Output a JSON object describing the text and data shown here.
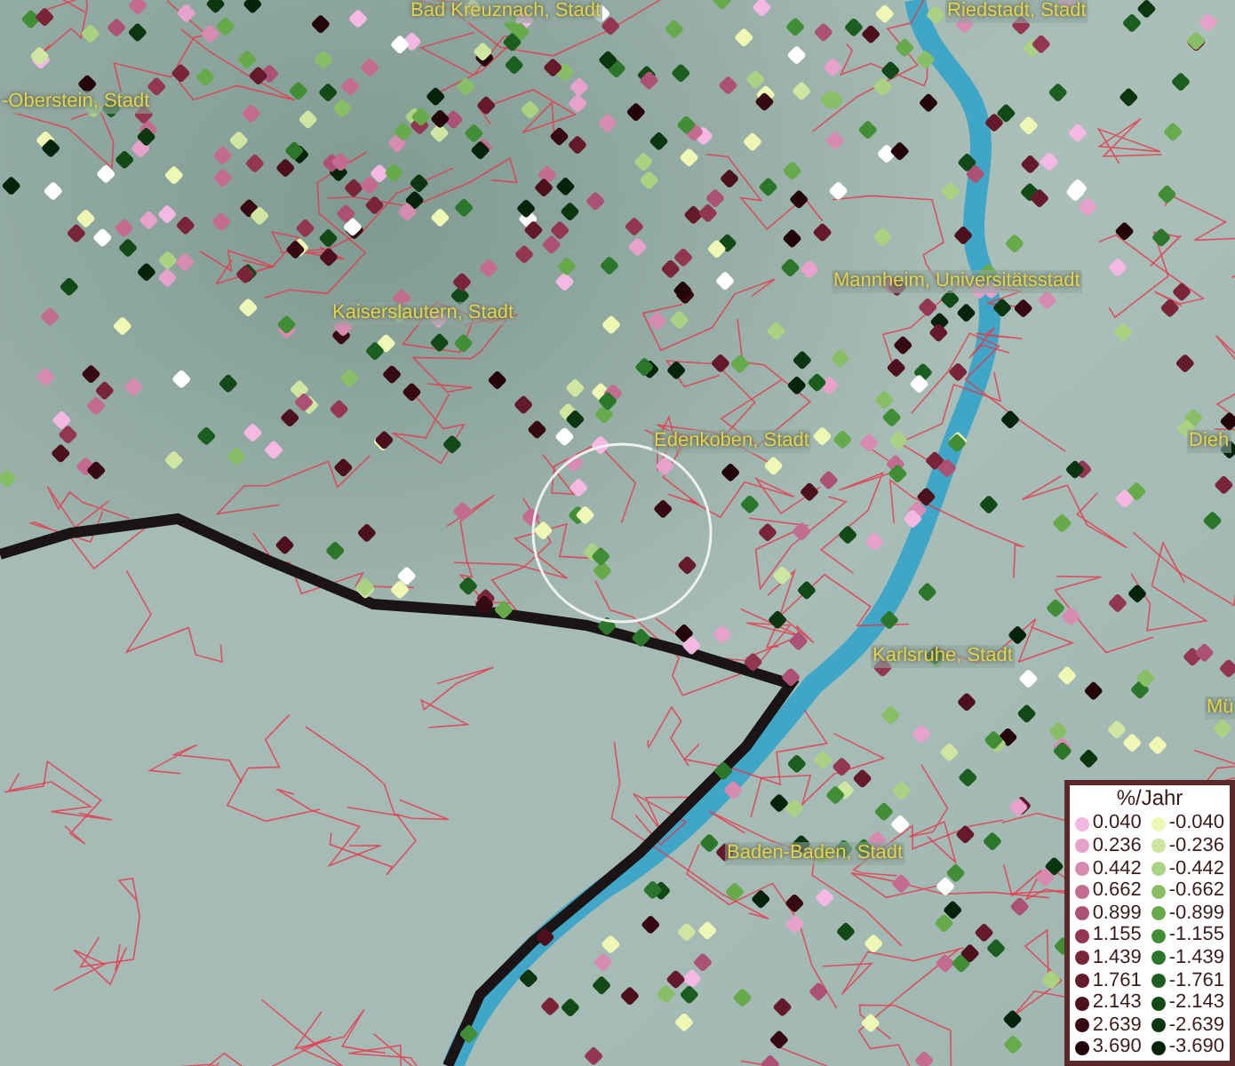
{
  "map": {
    "places": [
      {
        "name": "Bad Kreuznach, Stadt"
      },
      {
        "name": "Riedstadt, Stadt"
      },
      {
        "name": "-Oberstein, Stadt"
      },
      {
        "name": "Mannheim, Universitätsstadt"
      },
      {
        "name": "Kaiserslautern, Stadt"
      },
      {
        "name": "Edenkoben, Stadt"
      },
      {
        "name": "Dieh"
      },
      {
        "name": "Karlsruhe, Stadt"
      },
      {
        "name": "Mü"
      },
      {
        "name": "Baden-Baden, Stadt"
      }
    ]
  },
  "legend": {
    "title": "%/Jahr",
    "rows": [
      {
        "positive": {
          "label": "0.040",
          "color": "#f4b8e2"
        },
        "negative": {
          "label": "-0.040",
          "color": "#eef7b4"
        }
      },
      {
        "positive": {
          "label": "0.236",
          "color": "#e7a2cb"
        },
        "negative": {
          "label": "-0.236",
          "color": "#cfe6a2"
        }
      },
      {
        "positive": {
          "label": "0.442",
          "color": "#d88bb0"
        },
        "negative": {
          "label": "-0.442",
          "color": "#abd283"
        }
      },
      {
        "positive": {
          "label": "0.662",
          "color": "#c46c90"
        },
        "negative": {
          "label": "-0.662",
          "color": "#88bf66"
        }
      },
      {
        "positive": {
          "label": "0.899",
          "color": "#ac5074"
        },
        "negative": {
          "label": "-0.899",
          "color": "#66aa4c"
        }
      },
      {
        "positive": {
          "label": "1.155",
          "color": "#933652"
        },
        "negative": {
          "label": "-1.155",
          "color": "#418e36"
        }
      },
      {
        "positive": {
          "label": "1.439",
          "color": "#7a243a"
        },
        "negative": {
          "label": "-1.439",
          "color": "#2b762a"
        }
      },
      {
        "positive": {
          "label": "1.761",
          "color": "#641a2b"
        },
        "negative": {
          "label": "-1.761",
          "color": "#1c5e1f"
        }
      },
      {
        "positive": {
          "label": "2.143",
          "color": "#4d101d"
        },
        "negative": {
          "label": "-2.143",
          "color": "#124917"
        }
      },
      {
        "positive": {
          "label": "2.639",
          "color": "#370913"
        },
        "negative": {
          "label": "-2.639",
          "color": "#0b3610"
        }
      },
      {
        "positive": {
          "label": "3.690",
          "color": "#23040a"
        },
        "negative": {
          "label": "-3.690",
          "color": "#05230b"
        }
      }
    ]
  }
}
